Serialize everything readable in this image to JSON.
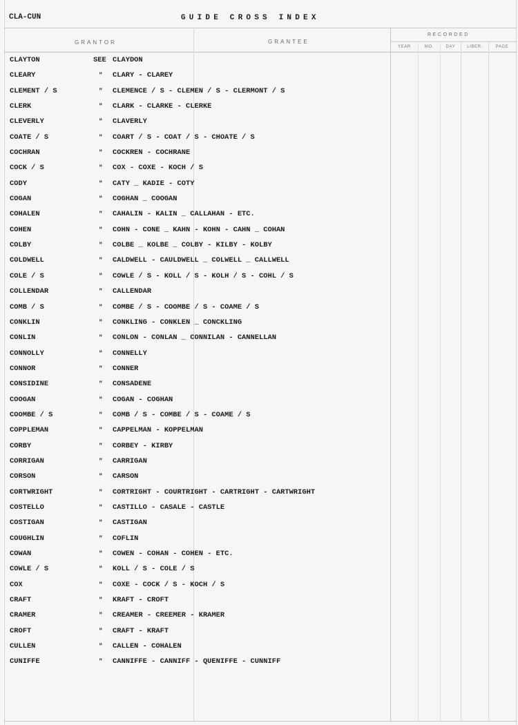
{
  "document": {
    "series_code": "CLA-CUN",
    "title": "GUIDE CROSS INDEX"
  },
  "header": {
    "grantor_label": "GRANTOR",
    "grantee_label": "GRANTEE",
    "recorded_label": "RECORDED",
    "recorded_columns": [
      "YEAR",
      "MO.",
      "DAY",
      "LIBER.",
      "PAGE"
    ]
  },
  "entries": [
    {
      "grantor": "CLAYTON",
      "ref": "SEE",
      "grantee": "CLAYDON"
    },
    {
      "grantor": "CLEARY",
      "ref": "\"",
      "grantee": "CLARY - CLAREY"
    },
    {
      "grantor": "CLEMENT / S",
      "ref": "\"",
      "grantee": "CLEMENCE / S - CLEMEN / S - CLERMONT / S"
    },
    {
      "grantor": "CLERK",
      "ref": "\"",
      "grantee": "CLARK - CLARKE - CLERKE"
    },
    {
      "grantor": "CLEVERLY",
      "ref": "\"",
      "grantee": "CLAVERLY"
    },
    {
      "grantor": "COATE / S",
      "ref": "\"",
      "grantee": "COART / S - COAT / S - CHOATE / S"
    },
    {
      "grantor": "COCHRAN",
      "ref": "\"",
      "grantee": "COCKREN - COCHRANE"
    },
    {
      "grantor": "COCK / S",
      "ref": "\"",
      "grantee": "COX - COXE - KOCH / S"
    },
    {
      "grantor": "CODY",
      "ref": "\"",
      "grantee": "CATY _ KADIE - COTY"
    },
    {
      "grantor": "COGAN",
      "ref": "\"",
      "grantee": "COGHAN _ COOGAN"
    },
    {
      "grantor": "COHALEN",
      "ref": "\"",
      "grantee": "CAHALIN - KALIN _ CALLAHAN - ETC."
    },
    {
      "grantor": "COHEN",
      "ref": "\"",
      "grantee": "COHN - CONE _ KAHN - KOHN - CAHN _ COHAN"
    },
    {
      "grantor": "COLBY",
      "ref": "\"",
      "grantee": "COLBE _ KOLBE _ COLBY - KILBY - KOLBY"
    },
    {
      "grantor": "COLDWELL",
      "ref": "\"",
      "grantee": "CALDWELL - CAULDWELL _ COLWELL _ CALLWELL"
    },
    {
      "grantor": "COLE / S",
      "ref": "\"",
      "grantee": "COWLE / S - KOLL / S - KOLH / S - COHL / S"
    },
    {
      "grantor": "COLLENDAR",
      "ref": "\"",
      "grantee": "CALLENDAR"
    },
    {
      "grantor": "COMB / S",
      "ref": "\"",
      "grantee": "COMBE / S - COOMBE / S - COAME / S"
    },
    {
      "grantor": "CONKLIN",
      "ref": "\"",
      "grantee": "CONKLING - CONKLEN _ CONCKLING"
    },
    {
      "grantor": "CONLIN",
      "ref": "\"",
      "grantee": "CONLON - CONLAN _ CONNILAN - CANNELLAN"
    },
    {
      "grantor": "CONNOLLY",
      "ref": "\"",
      "grantee": "CONNELLY"
    },
    {
      "grantor": "CONNOR",
      "ref": "\"",
      "grantee": "CONNER"
    },
    {
      "grantor": "CONSIDINE",
      "ref": "\"",
      "grantee": "CONSADENE"
    },
    {
      "grantor": "COOGAN",
      "ref": "\"",
      "grantee": "COGAN - COGHAN"
    },
    {
      "grantor": "COOMBE / S",
      "ref": "\"",
      "grantee": "COMB / S - COMBE / S - COAME / S"
    },
    {
      "grantor": "COPPLEMAN",
      "ref": "\"",
      "grantee": "CAPPELMAN - KOPPELMAN"
    },
    {
      "grantor": "CORBY",
      "ref": "\"",
      "grantee": "CORBEY - KIRBY"
    },
    {
      "grantor": "CORRIGAN",
      "ref": "\"",
      "grantee": "CARRIGAN"
    },
    {
      "grantor": "CORSON",
      "ref": "\"",
      "grantee": "CARSON"
    },
    {
      "grantor": "CORTWRIGHT",
      "ref": "\"",
      "grantee": "CORTRIGHT - COURTRIGHT - CARTRIGHT - CARTWRIGHT"
    },
    {
      "grantor": "COSTELLO",
      "ref": "\"",
      "grantee": "CASTILLO - CASALE - CASTLE"
    },
    {
      "grantor": "COSTIGAN",
      "ref": "\"",
      "grantee": "CASTIGAN"
    },
    {
      "grantor": "COUGHLIN",
      "ref": "\"",
      "grantee": "COFLIN"
    },
    {
      "grantor": "COWAN",
      "ref": "\"",
      "grantee": "COWEN - COHAN - COHEN - ETC."
    },
    {
      "grantor": "COWLE / S",
      "ref": "\"",
      "grantee": "KOLL / S - COLE / S"
    },
    {
      "grantor": "COX",
      "ref": "\"",
      "grantee": "COXE - COCK / S - KOCH / S"
    },
    {
      "grantor": "CRAFT",
      "ref": "\"",
      "grantee": "KRAFT - CROFT"
    },
    {
      "grantor": "CRAMER",
      "ref": "\"",
      "grantee": "CREAMER - CREEMER - KRAMER"
    },
    {
      "grantor": "CROFT",
      "ref": "\"",
      "grantee": "CRAFT - KRAFT"
    },
    {
      "grantor": "CULLEN",
      "ref": "\"",
      "grantee": "CALLEN - COHALEN"
    },
    {
      "grantor": "CUNIFFE",
      "ref": "\"",
      "grantee": "CANNIFFE - CANNIFF - QUENIFFE - CUNNIFF"
    }
  ]
}
